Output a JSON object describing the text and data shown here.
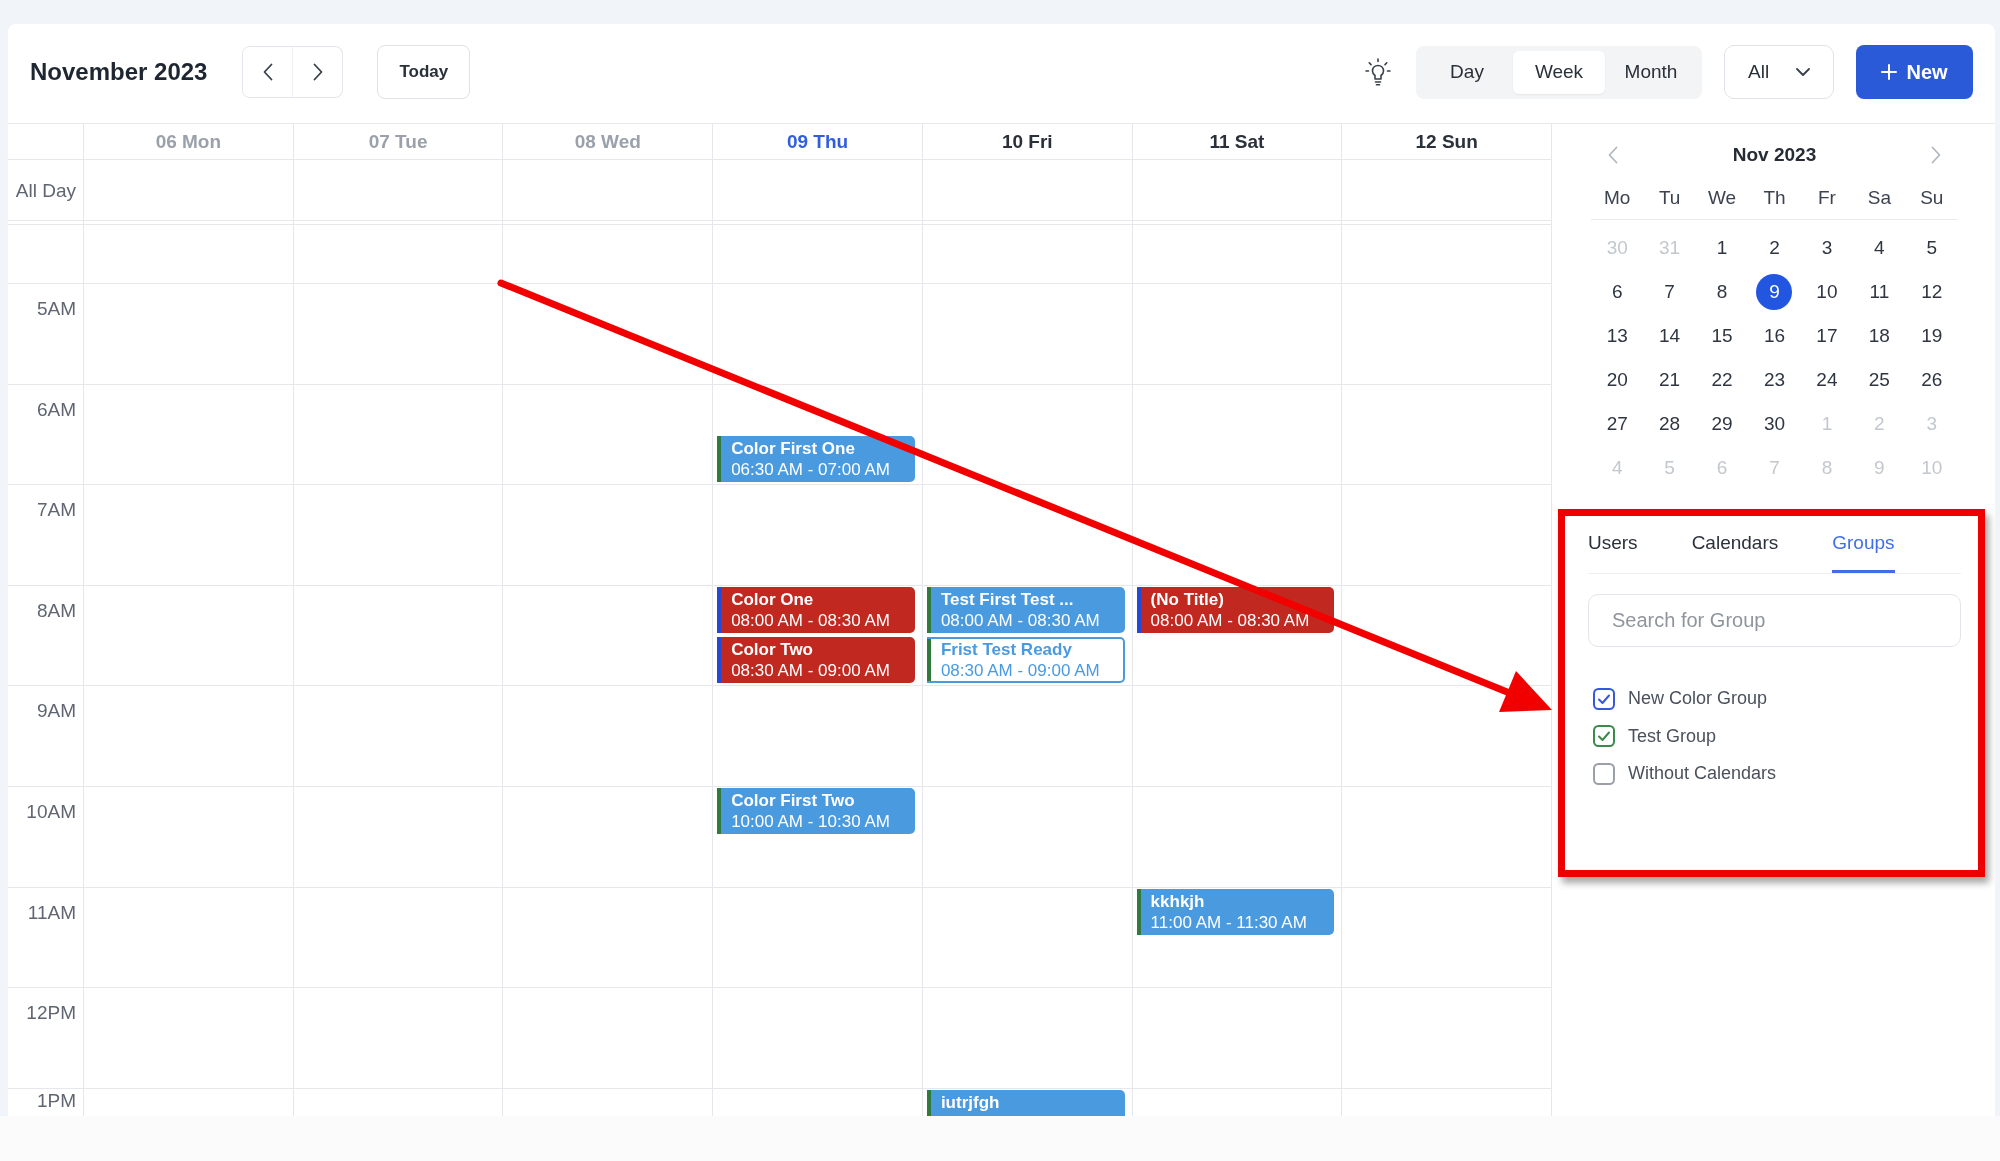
{
  "toolbar": {
    "title": "November 2023",
    "today_button": "Today",
    "views": [
      {
        "label": "Day",
        "selected": false
      },
      {
        "label": "Week",
        "selected": true
      },
      {
        "label": "Month",
        "selected": false
      }
    ],
    "filter": {
      "value": "All"
    },
    "new_button": "New"
  },
  "week": {
    "all_day_label": "All Day",
    "days": [
      {
        "label": "06 Mon",
        "past": true,
        "today": false
      },
      {
        "label": "07 Tue",
        "past": true,
        "today": false
      },
      {
        "label": "08 Wed",
        "past": true,
        "today": false
      },
      {
        "label": "09 Thu",
        "past": false,
        "today": true,
        "events": [
          {
            "title": "Color First One",
            "time": "06:30 AM - 07:00 AM",
            "continues_below": false,
            "kind": "filled",
            "color": "#4a9ae0",
            "accent": {
              "color": "#2f7a3c"
            }
          },
          {
            "title": "Color One",
            "time": "08:00 AM - 08:30 AM",
            "continues_below": false,
            "kind": "filled",
            "color": "#c1281f",
            "accent": {
              "color": "#2449d6"
            }
          },
          {
            "title": "Color Two",
            "time": "08:30 AM - 09:00 AM",
            "continues_below": false,
            "kind": "filled",
            "color": "#c1281f",
            "accent": {
              "color": "#2449d6"
            }
          },
          {
            "title": "Color First Two",
            "time": "10:00 AM - 10:30 AM",
            "continues_below": false,
            "kind": "filled",
            "color": "#4a9ae0",
            "accent": {
              "color": "#2f7a3c"
            }
          }
        ]
      },
      {
        "label": "10 Fri",
        "past": false,
        "today": false,
        "events": [
          {
            "title": "Test First Test ...",
            "time": "08:00 AM - 08:30 AM",
            "continues_below": false,
            "kind": "filled",
            "color": "#4a9ae0",
            "accent": {
              "color": "#2f7a3c"
            }
          },
          {
            "title": "Frist Test Ready",
            "time": "08:30 AM - 09:00 AM",
            "continues_below": false,
            "kind": "outline",
            "color": "#4a9ae0",
            "accent": {
              "color": "#2f7a3c"
            }
          },
          {
            "title": "iutrjfgh",
            "continues_below": true,
            "kind": "filled",
            "color": "#4a9ae0",
            "accent": {
              "color": "#2f7a3c"
            }
          }
        ]
      },
      {
        "label": "11 Sat",
        "past": false,
        "today": false,
        "events": [
          {
            "title": "(No Title)",
            "time": "08:00 AM - 08:30 AM",
            "continues_below": false,
            "kind": "filled",
            "color": "#c1281f",
            "accent": {
              "color": "#2449d6"
            }
          },
          {
            "title": "kkhkjh",
            "time": "11:00 AM - 11:30 AM",
            "continues_below": false,
            "kind": "filled",
            "color": "#4a9ae0",
            "accent": {
              "color": "#2f7a3c"
            }
          }
        ]
      },
      {
        "label": "12 Sun",
        "past": false,
        "today": false
      }
    ],
    "hours": [
      "5AM",
      "6AM",
      "7AM",
      "8AM",
      "9AM",
      "10AM",
      "11AM",
      "12PM",
      "1PM"
    ]
  },
  "mini_calendar": {
    "title": "Nov 2023",
    "weekdays": [
      "Mo",
      "Tu",
      "We",
      "Th",
      "Fr",
      "Sa",
      "Su"
    ],
    "weeks": [
      [
        {
          "label": "30",
          "other_month": true,
          "selected": false
        },
        {
          "label": "31",
          "other_month": true,
          "selected": false
        },
        {
          "label": "1",
          "other_month": false,
          "selected": false
        },
        {
          "label": "2",
          "other_month": false,
          "selected": false
        },
        {
          "label": "3",
          "other_month": false,
          "selected": false
        },
        {
          "label": "4",
          "other_month": false,
          "selected": false
        },
        {
          "label": "5",
          "other_month": false,
          "selected": false
        }
      ],
      [
        {
          "label": "6",
          "other_month": false,
          "selected": false
        },
        {
          "label": "7",
          "other_month": false,
          "selected": false
        },
        {
          "label": "8",
          "other_month": false,
          "selected": false
        },
        {
          "label": "9",
          "other_month": false,
          "selected": true
        },
        {
          "label": "10",
          "other_month": false,
          "selected": false
        },
        {
          "label": "11",
          "other_month": false,
          "selected": false
        },
        {
          "label": "12",
          "other_month": false,
          "selected": false
        }
      ],
      [
        {
          "label": "13",
          "other_month": false,
          "selected": false
        },
        {
          "label": "14",
          "other_month": false,
          "selected": false
        },
        {
          "label": "15",
          "other_month": false,
          "selected": false
        },
        {
          "label": "16",
          "other_month": false,
          "selected": false
        },
        {
          "label": "17",
          "other_month": false,
          "selected": false
        },
        {
          "label": "18",
          "other_month": false,
          "selected": false
        },
        {
          "label": "19",
          "other_month": false,
          "selected": false
        }
      ],
      [
        {
          "label": "20",
          "other_month": false,
          "selected": false
        },
        {
          "label": "21",
          "other_month": false,
          "selected": false
        },
        {
          "label": "22",
          "other_month": false,
          "selected": false
        },
        {
          "label": "23",
          "other_month": false,
          "selected": false
        },
        {
          "label": "24",
          "other_month": false,
          "selected": false
        },
        {
          "label": "25",
          "other_month": false,
          "selected": false
        },
        {
          "label": "26",
          "other_month": false,
          "selected": false
        }
      ],
      [
        {
          "label": "27",
          "other_month": false,
          "selected": false
        },
        {
          "label": "28",
          "other_month": false,
          "selected": false
        },
        {
          "label": "29",
          "other_month": false,
          "selected": false
        },
        {
          "label": "30",
          "other_month": false,
          "selected": false
        },
        {
          "label": "1",
          "other_month": true,
          "selected": false
        },
        {
          "label": "2",
          "other_month": true,
          "selected": false
        },
        {
          "label": "3",
          "other_month": true,
          "selected": false
        }
      ],
      [
        {
          "label": "4",
          "other_month": true,
          "selected": false
        },
        {
          "label": "5",
          "other_month": true,
          "selected": false
        },
        {
          "label": "6",
          "other_month": true,
          "selected": false
        },
        {
          "label": "7",
          "other_month": true,
          "selected": false
        },
        {
          "label": "8",
          "other_month": true,
          "selected": false
        },
        {
          "label": "9",
          "other_month": true,
          "selected": false
        },
        {
          "label": "10",
          "other_month": true,
          "selected": false
        }
      ]
    ]
  },
  "filter_panel": {
    "highlighted": true,
    "tabs": [
      {
        "label": "Users",
        "selected": false
      },
      {
        "label": "Calendars",
        "selected": false
      },
      {
        "label": "Groups",
        "selected": true
      }
    ],
    "search": {
      "placeholder": "Search for Group"
    },
    "groups": [
      {
        "label": "New Color Group",
        "checked": true,
        "color": "#3858dc"
      },
      {
        "label": "Test Group",
        "checked": true,
        "color": "#3b8a4c"
      },
      {
        "label": "Without Calendars",
        "checked": false,
        "color": "#9ba0a8"
      }
    ]
  },
  "annotations": [
    {
      "kind": "arrow"
    }
  ]
}
